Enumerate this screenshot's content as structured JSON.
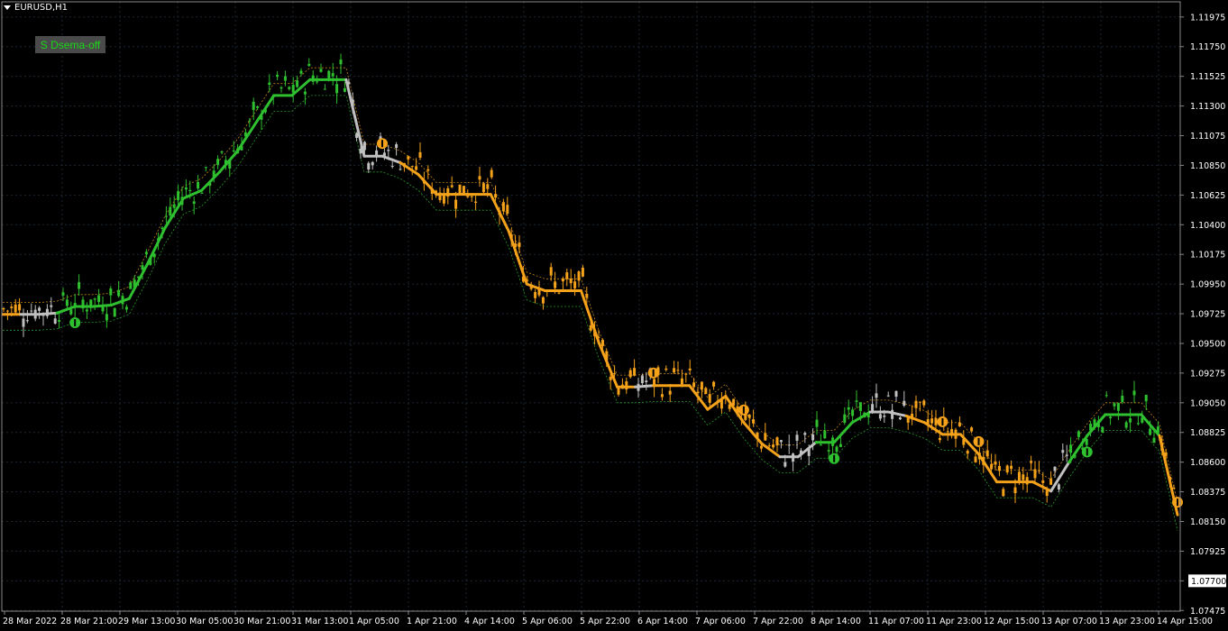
{
  "chart_data": {
    "type": "candlestick",
    "symbol_label": "EURUSD,H1",
    "indicator_button": "S Dsema-off",
    "y_range": [
      1.0747,
      1.1209
    ],
    "y_ticks": [
      "1.11975",
      "1.11750",
      "1.11525",
      "1.11300",
      "1.11075",
      "1.10850",
      "1.10625",
      "1.10400",
      "1.10175",
      "1.09950",
      "1.09725",
      "1.09500",
      "1.09275",
      "1.09050",
      "1.08825",
      "1.08600",
      "1.08375",
      "1.08150",
      "1.07925",
      "1.07700",
      "1.07475"
    ],
    "current_price": "1.07700",
    "x_labels": [
      "28 Mar 2022",
      "28 Mar 21:00",
      "29 Mar 13:00",
      "30 Mar 05:00",
      "30 Mar 21:00",
      "31 Mar 13:00",
      "1 Apr 05:00",
      "1 Apr 21:00",
      "4 Apr 14:00",
      "5 Apr 06:00",
      "5 Apr 22:00",
      "6 Apr 14:00",
      "7 Apr 06:00",
      "7 Apr 22:00",
      "8 Apr 14:00",
      "11 Apr 07:00",
      "11 Apr 23:00",
      "12 Apr 15:00",
      "13 Apr 07:00",
      "13 Apr 23:00",
      "14 Apr 15:00"
    ],
    "colors": {
      "up": "#2fc02f",
      "down": "#f5a21b",
      "neutral": "#c0c0c0",
      "background": "#000000",
      "grid": "#1c2733"
    },
    "main_line_points": [
      [
        0,
        1.0972
      ],
      [
        1,
        1.0972
      ],
      [
        2,
        1.0972
      ],
      [
        3,
        1.0973
      ],
      [
        4,
        1.0978
      ],
      [
        5,
        1.0978
      ],
      [
        6,
        1.0979
      ],
      [
        7,
        1.0984
      ],
      [
        8,
        1.101
      ],
      [
        9,
        1.1038
      ],
      [
        10,
        1.106
      ],
      [
        11,
        1.1066
      ],
      [
        12,
        1.108
      ],
      [
        13,
        1.1096
      ],
      [
        14,
        1.1117
      ],
      [
        15,
        1.1138
      ],
      [
        16,
        1.1138
      ],
      [
        17,
        1.115
      ],
      [
        18,
        1.115
      ],
      [
        19,
        1.115
      ],
      [
        20,
        1.1092
      ],
      [
        21,
        1.1092
      ],
      [
        22,
        1.1087
      ],
      [
        23,
        1.1078
      ],
      [
        24,
        1.1063
      ],
      [
        25,
        1.1063
      ],
      [
        26,
        1.1063
      ],
      [
        27,
        1.1063
      ],
      [
        28,
        1.1035
      ],
      [
        29,
        1.0995
      ],
      [
        30,
        1.099
      ],
      [
        31,
        1.099
      ],
      [
        32,
        1.099
      ],
      [
        33,
        1.095
      ],
      [
        34,
        1.0917
      ],
      [
        35,
        1.0917
      ],
      [
        36,
        1.0918
      ],
      [
        37,
        1.0918
      ],
      [
        38,
        1.0918
      ],
      [
        39,
        1.09
      ],
      [
        40,
        1.091
      ],
      [
        41,
        1.089
      ],
      [
        42,
        1.0874
      ],
      [
        43,
        1.0864
      ],
      [
        44,
        1.0864
      ],
      [
        45,
        1.0875
      ],
      [
        46,
        1.0875
      ],
      [
        47,
        1.089
      ],
      [
        48,
        1.0898
      ],
      [
        49,
        1.0898
      ],
      [
        50,
        1.0895
      ],
      [
        51,
        1.089
      ],
      [
        52,
        1.0881
      ],
      [
        53,
        1.0881
      ],
      [
        54,
        1.0866
      ],
      [
        55,
        1.0845
      ],
      [
        56,
        1.0845
      ],
      [
        57,
        1.0845
      ],
      [
        58,
        1.0838
      ],
      [
        59,
        1.086
      ],
      [
        60,
        1.088
      ],
      [
        61,
        1.0896
      ],
      [
        62,
        1.0896
      ],
      [
        63,
        1.0896
      ],
      [
        64,
        1.088
      ],
      [
        65,
        1.082
      ]
    ],
    "main_line_segment_colors": [
      "down",
      "neutral",
      "neutral",
      "up",
      "up",
      "up",
      "up",
      "up",
      "up",
      "up",
      "up",
      "up",
      "up",
      "up",
      "up",
      "up",
      "up",
      "up",
      "up",
      "neutral",
      "neutral",
      "neutral",
      "down",
      "down",
      "down",
      "down",
      "down",
      "down",
      "down",
      "down",
      "down",
      "down",
      "down",
      "down",
      "down",
      "neutral",
      "down",
      "down",
      "down",
      "down",
      "down",
      "down",
      "down",
      "neutral",
      "neutral",
      "up",
      "up",
      "up",
      "neutral",
      "neutral",
      "down",
      "down",
      "down",
      "down",
      "down",
      "down",
      "down",
      "down",
      "neutral",
      "up",
      "up",
      "up",
      "up",
      "up",
      "down"
    ],
    "signal_arrows": [
      {
        "i": 4,
        "dir": "up"
      },
      {
        "i": 21,
        "dir": "down"
      },
      {
        "i": 36,
        "dir": "down"
      },
      {
        "i": 41,
        "dir": "down"
      },
      {
        "i": 46,
        "dir": "up"
      },
      {
        "i": 52,
        "dir": "down"
      },
      {
        "i": 54,
        "dir": "down"
      },
      {
        "i": 60,
        "dir": "up"
      },
      {
        "i": 65,
        "dir": "down"
      }
    ]
  }
}
